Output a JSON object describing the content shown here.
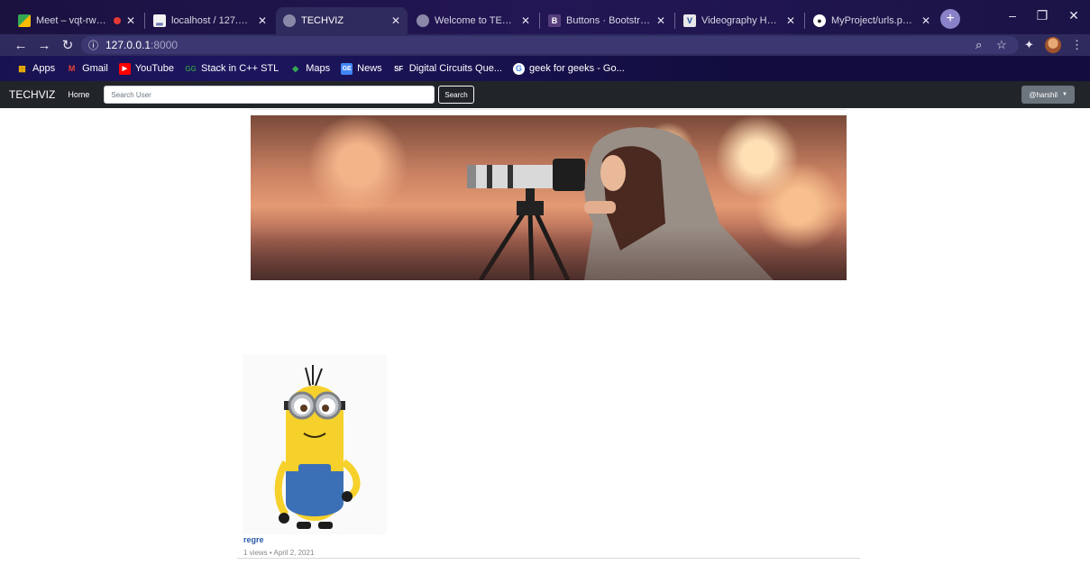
{
  "browser": {
    "tabs": [
      {
        "label": "Meet – vqt-rwwm-",
        "favicon": "meet-icon",
        "recording": true,
        "active": false
      },
      {
        "label": "localhost / 127.0.0.1 / d",
        "favicon": "phpmyadmin-icon",
        "active": false
      },
      {
        "label": "TECHVIZ",
        "favicon": "globe-icon",
        "active": true
      },
      {
        "label": "Welcome to TECHVIZ!",
        "favicon": "globe-icon",
        "active": false
      },
      {
        "label": "Buttons · Bootstrap",
        "favicon": "bootstrap-icon",
        "active": false
      },
      {
        "label": "Videography Help and",
        "favicon": "videohelp-icon",
        "active": false
      },
      {
        "label": "MyProject/urls.py at m",
        "favicon": "github-icon",
        "active": false
      }
    ],
    "address": {
      "host": "127.0.0.1",
      "port": ":8000"
    },
    "bookmarks": [
      {
        "label": "Apps",
        "icon": "apps-grid-icon"
      },
      {
        "label": "Gmail",
        "icon": "gmail-icon"
      },
      {
        "label": "YouTube",
        "icon": "youtube-icon"
      },
      {
        "label": "Stack in C++ STL",
        "icon": "gfg-icon"
      },
      {
        "label": "Maps",
        "icon": "maps-icon"
      },
      {
        "label": "News",
        "icon": "news-icon"
      },
      {
        "label": "Digital Circuits Que...",
        "icon": "sanfoundry-icon"
      },
      {
        "label": "geek for geeks - Go...",
        "icon": "google-icon"
      }
    ]
  },
  "site": {
    "brand": "TECHVIZ",
    "nav_home": "Home",
    "search_placeholder": "Search User",
    "search_button": "Search",
    "user": "@harshil"
  },
  "video": {
    "title": "regre",
    "meta": "1 views • April 2, 2021"
  },
  "colors": {
    "navbar": "#212529",
    "link": "#2a5aa8",
    "user_button": "#6c757d"
  }
}
